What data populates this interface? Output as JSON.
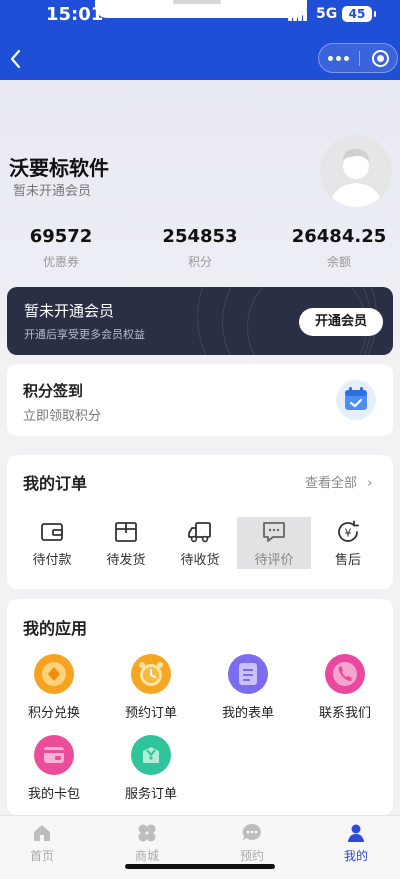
{
  "status_bar": {
    "time": "15:01",
    "network": "5G",
    "battery": "45"
  },
  "user": {
    "name": "沃要标软件",
    "membership_status": "暂未开通会员"
  },
  "stats": [
    {
      "value": "69572",
      "label": "优惠券"
    },
    {
      "value": "254853",
      "label": "积分"
    },
    {
      "value": "26484.25",
      "label": "余额"
    }
  ],
  "member_card": {
    "title": "暂未开通会员",
    "subtitle": "开通后享受更多会员权益",
    "button": "开通会员"
  },
  "checkin": {
    "title": "积分签到",
    "subtitle": "立即领取积分"
  },
  "orders": {
    "title": "我的订单",
    "view_all": "查看全部",
    "view_all_chevron": "›",
    "items": [
      {
        "label": "待付款",
        "icon": "wallet-icon"
      },
      {
        "label": "待发货",
        "icon": "package-icon"
      },
      {
        "label": "待收货",
        "icon": "truck-icon"
      },
      {
        "label": "待评价",
        "icon": "comment-icon"
      },
      {
        "label": "售后",
        "icon": "yuan-refund-icon"
      }
    ]
  },
  "apps": {
    "title": "我的应用",
    "items": [
      {
        "label": "积分兑换",
        "icon": "points-exchange-icon",
        "color": "#f7a321"
      },
      {
        "label": "预约订单",
        "icon": "alarm-clock-icon",
        "color": "#f5a623"
      },
      {
        "label": "我的表单",
        "icon": "form-icon",
        "color": "#7b6cf0"
      },
      {
        "label": "联系我们",
        "icon": "phone-icon",
        "color": "#e9489f"
      },
      {
        "label": "我的卡包",
        "icon": "card-wallet-icon",
        "color": "#ec4d9b"
      },
      {
        "label": "服务订单",
        "icon": "service-order-icon",
        "color": "#2fc49a"
      }
    ]
  },
  "tabbar": {
    "items": [
      {
        "label": "首页",
        "icon": "home-icon"
      },
      {
        "label": "商城",
        "icon": "mall-icon"
      },
      {
        "label": "预约",
        "icon": "chat-icon"
      },
      {
        "label": "我的",
        "icon": "user-icon"
      }
    ]
  },
  "colors": {
    "primary": "#1f4fd6",
    "tab_active": "#2d4bd8",
    "member_card": "#2a2f46"
  }
}
